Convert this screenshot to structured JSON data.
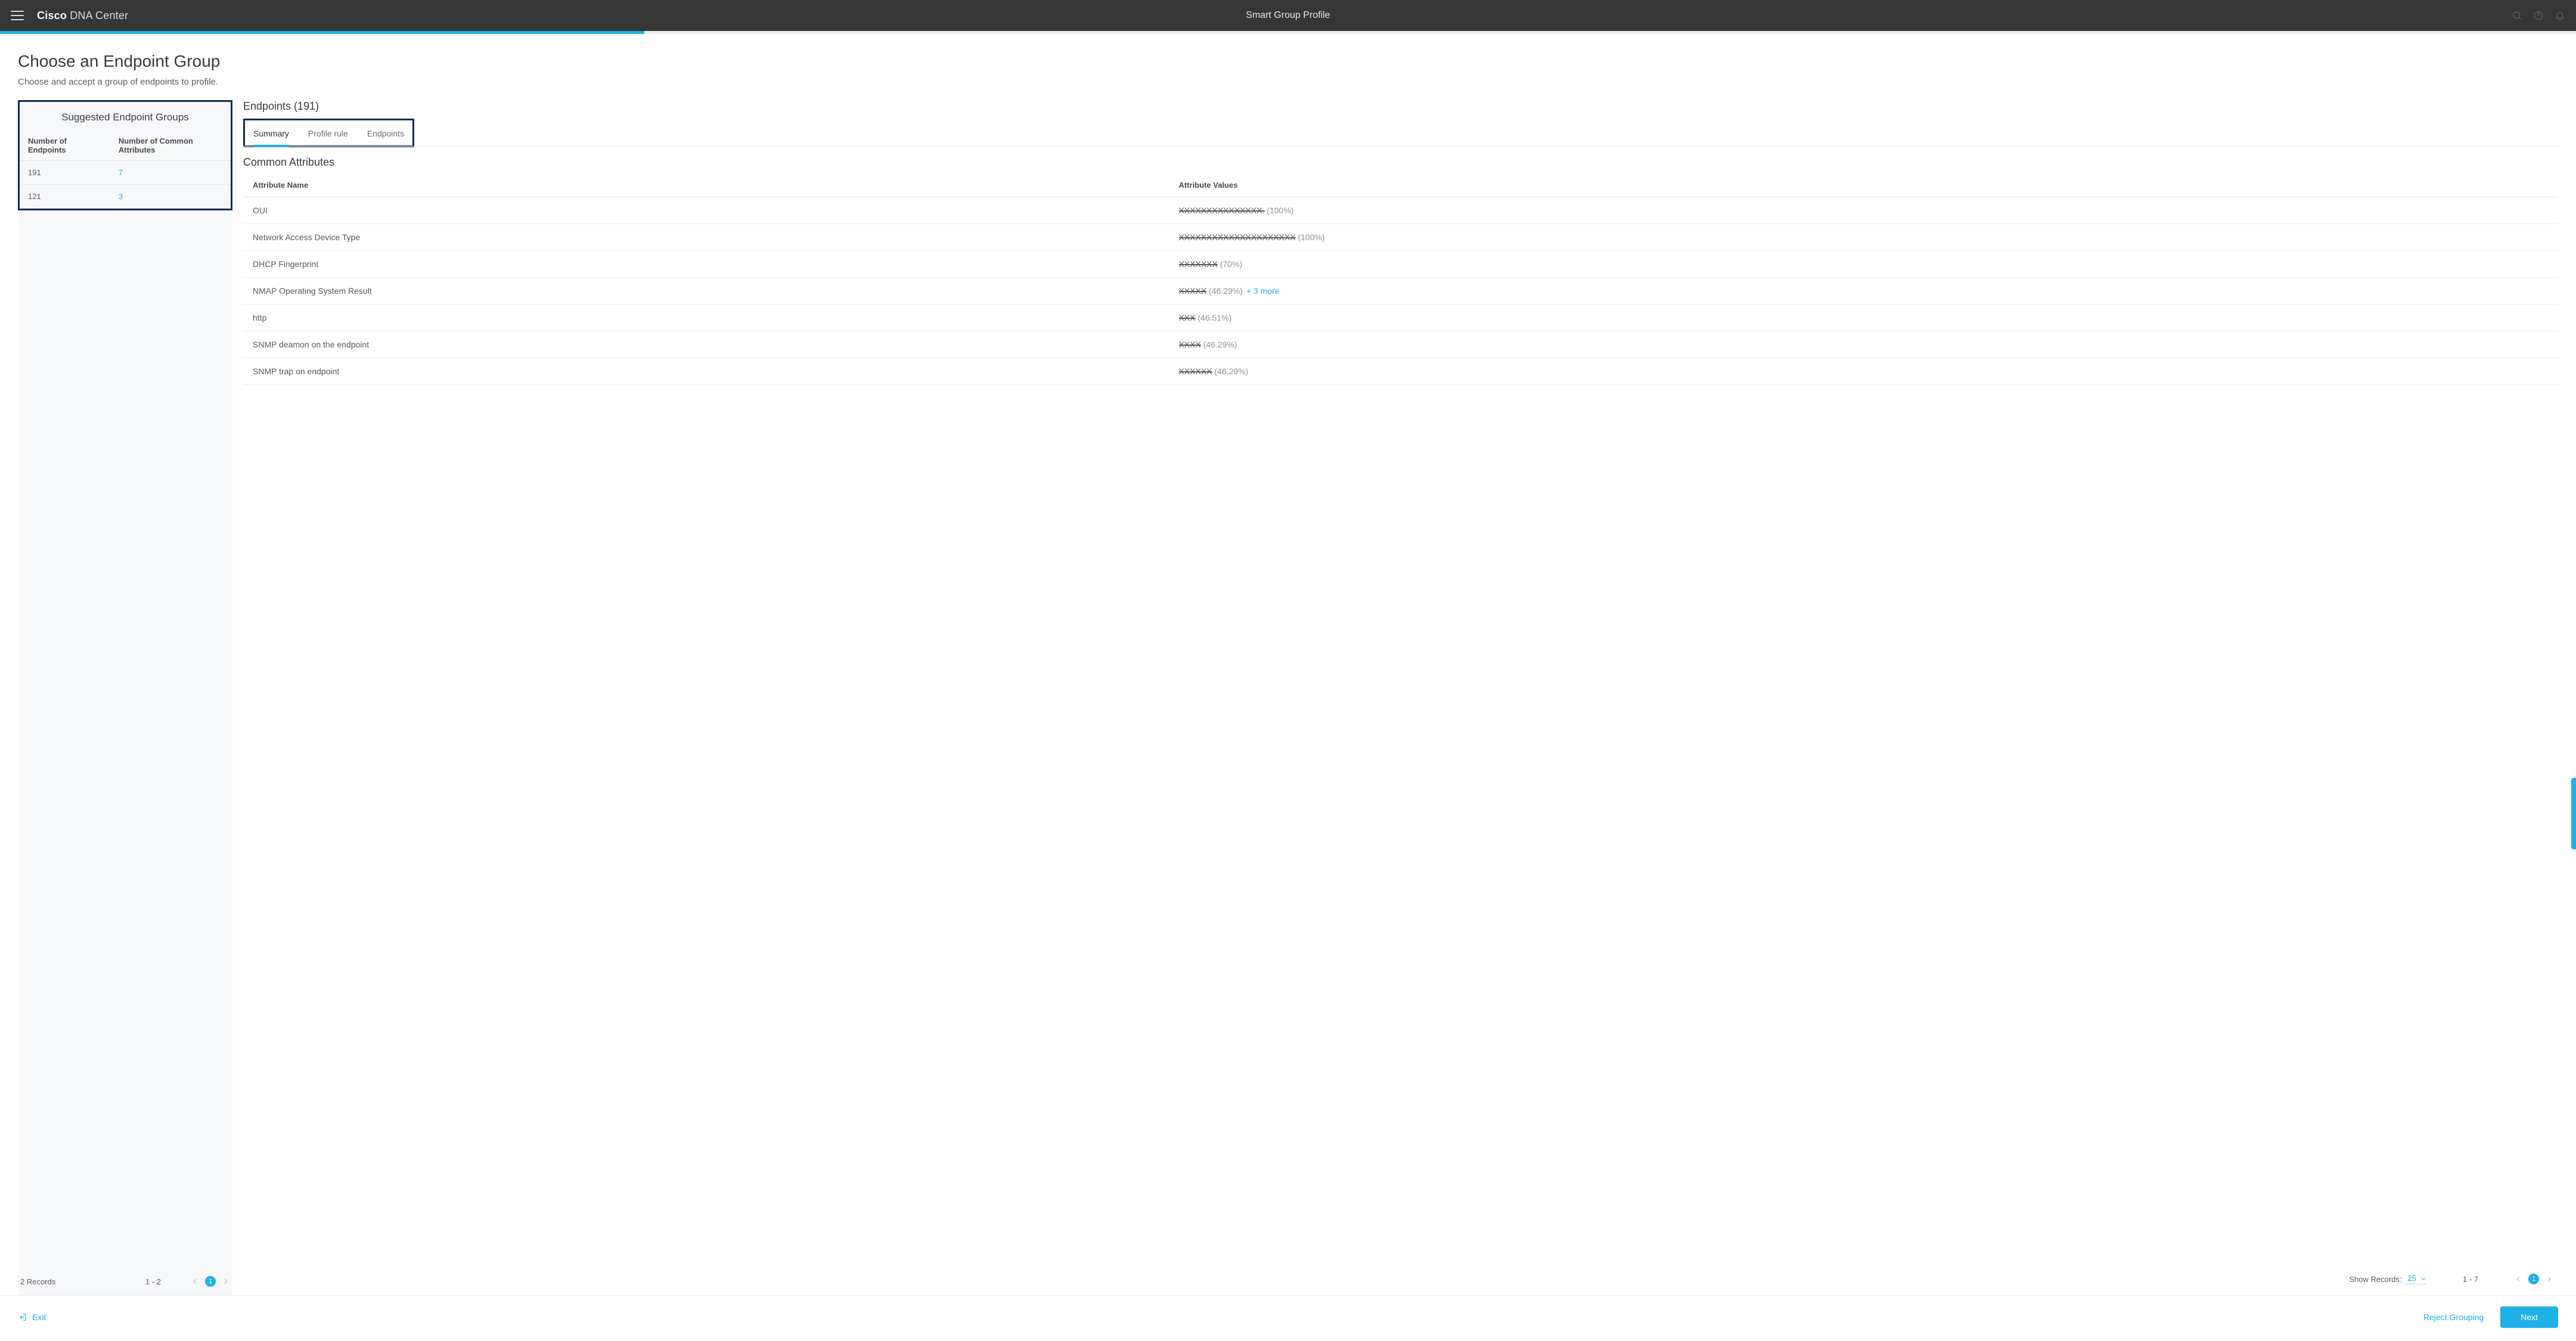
{
  "header": {
    "brand_bold": "Cisco",
    "brand_light": "DNA Center",
    "center_title": "Smart Group Profile"
  },
  "page": {
    "title": "Choose an Endpoint Group",
    "subtitle": "Choose and accept a group of endpoints to profile."
  },
  "left": {
    "title": "Suggested Endpoint Groups",
    "col_endpoints": "Number of Endpoints",
    "col_attrs": "Number of Common Attributes",
    "rows": [
      {
        "endpoints": "191",
        "attrs": "7"
      },
      {
        "endpoints": "121",
        "attrs": "3"
      }
    ],
    "records_label": "2 Records",
    "range": "1 - 2",
    "page": "1"
  },
  "right": {
    "title": "Endpoints (191)",
    "tabs": {
      "summary": "Summary",
      "profile_rule": "Profile rule",
      "endpoints": "Endpoints"
    },
    "section": "Common Attributes",
    "col_name": "Attribute Name",
    "col_values": "Attribute Values",
    "rows": [
      {
        "name": "OUI",
        "value": "XXXXXXXXXXXXXXX.",
        "pct": "(100%)",
        "more": ""
      },
      {
        "name": "Network Access Device Type",
        "value": "XXXXXXXXXXXXXXXXXXXXX",
        "pct": "(100%)",
        "more": ""
      },
      {
        "name": "DHCP Fingerprint",
        "value": "XXXXXXX",
        "pct": "(70%)",
        "more": ""
      },
      {
        "name": "NMAP Operating System Result",
        "value": "XXXXX",
        "pct": "(46.29%)",
        "more": "+ 3 more"
      },
      {
        "name": "http",
        "value": "XXX",
        "pct": "(46.51%)",
        "more": ""
      },
      {
        "name": "SNMP deamon on the endpoint",
        "value": "XXXX",
        "pct": "(46.29%)",
        "more": ""
      },
      {
        "name": "SNMP trap on endpoint",
        "value": "XXXXXX",
        "pct": "(46.29%)",
        "more": ""
      }
    ],
    "show_records_label": "Show Records:",
    "show_records_value": "25",
    "range": "1 - 7",
    "page": "1"
  },
  "footer": {
    "exit": "Exit",
    "reject": "Reject Grouping",
    "next": "Next"
  }
}
